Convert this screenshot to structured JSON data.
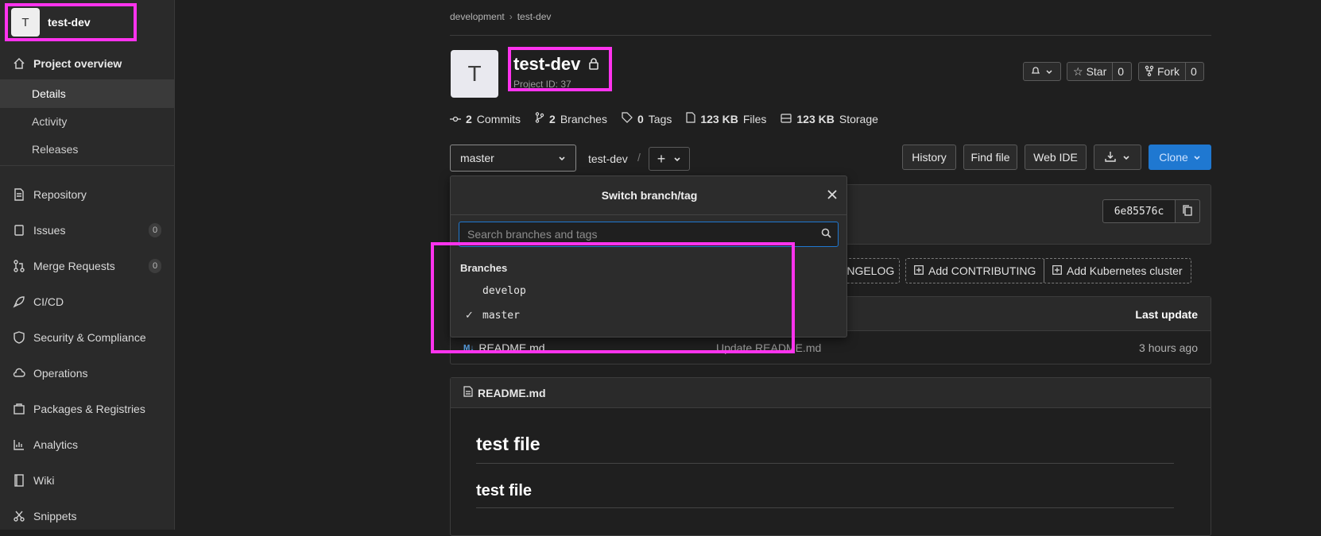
{
  "project": {
    "initial": "T",
    "name": "test-dev",
    "id_text": "Project ID: 37"
  },
  "sidebar": {
    "overview": "Project overview",
    "sub": [
      "Details",
      "Activity",
      "Releases"
    ],
    "items": [
      {
        "label": "Repository"
      },
      {
        "label": "Issues",
        "count": "0"
      },
      {
        "label": "Merge Requests",
        "count": "0"
      },
      {
        "label": "CI/CD"
      },
      {
        "label": "Security & Compliance"
      },
      {
        "label": "Operations"
      },
      {
        "label": "Packages & Registries"
      },
      {
        "label": "Analytics"
      },
      {
        "label": "Wiki"
      },
      {
        "label": "Snippets"
      }
    ]
  },
  "breadcrumbs": [
    "development",
    "test-dev"
  ],
  "header_buttons": {
    "star_label": "Star",
    "star_count": "0",
    "fork_label": "Fork",
    "fork_count": "0"
  },
  "stats": {
    "commits_num": "2",
    "commits_label": "Commits",
    "branches_num": "2",
    "branches_label": "Branches",
    "tags_num": "0",
    "tags_label": "Tags",
    "files_num": "123 KB",
    "files_label": "Files",
    "storage_num": "123 KB",
    "storage_label": "Storage"
  },
  "toolbar": {
    "branch": "master",
    "path": "test-dev",
    "path_sep": "/",
    "history": "History",
    "find_file": "Find file",
    "web_ide": "Web IDE",
    "clone": "Clone"
  },
  "commit": {
    "sha": "6e85576c"
  },
  "quick_actions": [
    "ANGELOG",
    "Add CONTRIBUTING",
    "Add Kubernetes cluster"
  ],
  "files": {
    "last_update_header": "Last update",
    "rows": [
      {
        "name": "README.md",
        "message": "Update README.md",
        "time": "3 hours ago"
      }
    ]
  },
  "readme": {
    "title": "README.md",
    "h1": "test file",
    "h2": "test file"
  },
  "dropdown": {
    "title": "Switch branch/tag",
    "search_placeholder": "Search branches and tags",
    "section": "Branches",
    "branches": [
      {
        "name": "develop",
        "selected": false
      },
      {
        "name": "master",
        "selected": true
      }
    ]
  },
  "colors": {
    "highlight": "#ff33ee",
    "accent": "#1f78d1"
  }
}
